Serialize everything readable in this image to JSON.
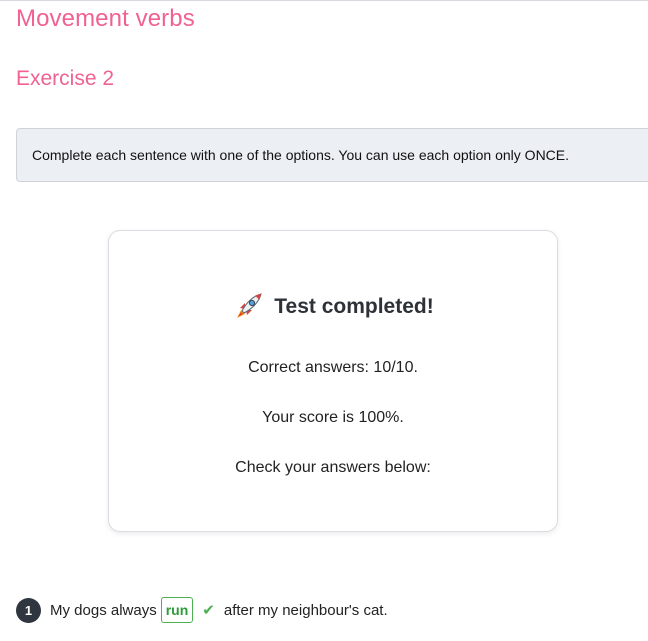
{
  "page": {
    "title": "Movement verbs",
    "exercise_title": "Exercise 2",
    "instructions": "Complete each sentence with one of the options. You can use each option only ONCE."
  },
  "result": {
    "icon": "rocket-icon",
    "title": "Test completed!",
    "correct_answers": "Correct answers: 10/10.",
    "score": "Your score is 100%.",
    "check_prompt": "Check your answers below:"
  },
  "questions": [
    {
      "number": "1",
      "before": "My dogs always",
      "answer": "run",
      "after": "after my neighbour's cat.",
      "status_icon": "check-icon"
    }
  ],
  "colors": {
    "accent": "#f06292",
    "correct": "#4caf50"
  }
}
